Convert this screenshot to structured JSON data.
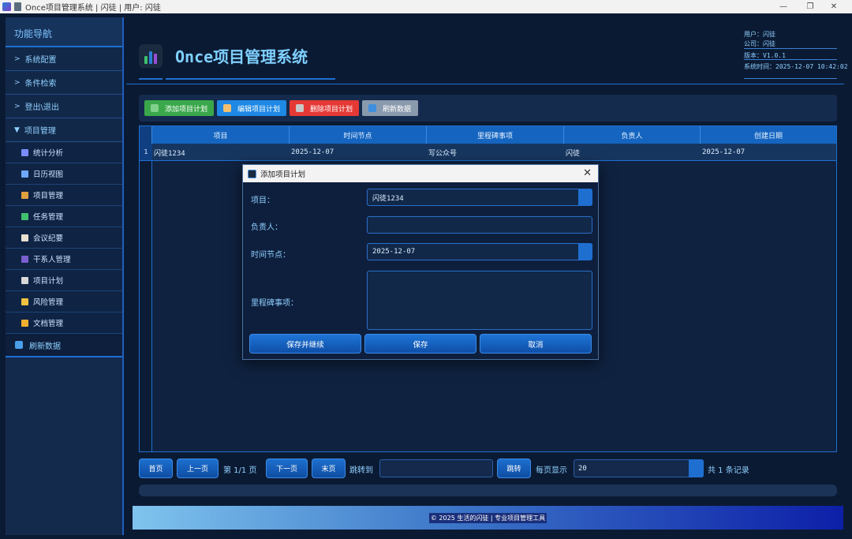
{
  "window": {
    "title": "Once项目管理系统 | 闪徒 | 用户: 闪徒"
  },
  "sidebar": {
    "header": "功能导航",
    "groups": [
      {
        "label": "系统配置",
        "chevron": ">"
      },
      {
        "label": "条件检索",
        "chevron": ">"
      },
      {
        "label": "登出\\退出",
        "chevron": ">"
      },
      {
        "label": "项目管理",
        "chevron": "▼"
      }
    ],
    "subitems": [
      {
        "label": "统计分析",
        "icon": "chart-icon",
        "color": "#7a8cff"
      },
      {
        "label": "日历视图",
        "icon": "calendar-icon",
        "color": "#6fa8ff"
      },
      {
        "label": "项目管理",
        "icon": "project-icon",
        "color": "#e0a040"
      },
      {
        "label": "任务管理",
        "icon": "check-icon",
        "color": "#3fbf6f"
      },
      {
        "label": "会议纪要",
        "icon": "memo-icon",
        "color": "#e8e0d0"
      },
      {
        "label": "干系人管理",
        "icon": "people-icon",
        "color": "#7a5fd0"
      },
      {
        "label": "项目计划",
        "icon": "clipboard-icon",
        "color": "#d8d8d8"
      },
      {
        "label": "风险管理",
        "icon": "warning-icon",
        "color": "#f0c040"
      },
      {
        "label": "文档管理",
        "icon": "folder-icon",
        "color": "#f0b030"
      }
    ],
    "refresh": "刷新数据"
  },
  "header": {
    "title": "Once项目管理系统",
    "user": "用户：闪徒",
    "company": "公司：闪徒",
    "version": "版本：V1.0.1",
    "time": "系统时间：2025-12-07 10:42:02"
  },
  "toolbar": {
    "add": "添加项目计划",
    "edit": "编辑项目计划",
    "delete": "删除项目计划",
    "refresh": "刷新数据"
  },
  "table": {
    "columns": [
      "项目",
      "时间节点",
      "里程碑事项",
      "负责人",
      "创建日期"
    ],
    "rows": [
      {
        "index": "1",
        "cells": [
          "闪徒1234",
          "2025-12-07",
          "写公众号",
          "闪徒",
          "2025-12-07"
        ]
      }
    ]
  },
  "dialog": {
    "title": "添加项目计划",
    "fields": {
      "project_label": "项目：",
      "project_value": "闪徒1234",
      "owner_label": "负责人：",
      "owner_value": "",
      "date_label": "时间节点：",
      "date_value": "2025-12-07",
      "milestone_label": "里程碑事项：",
      "milestone_value": ""
    },
    "buttons": {
      "save_continue": "保存并继续",
      "save": "保存",
      "cancel": "取消"
    }
  },
  "pagination": {
    "first": "首页",
    "prev": "上一页",
    "page_info": "第 1/1 页",
    "next": "下一页",
    "last": "末页",
    "jump_label": "跳转到",
    "jump_value": "",
    "jump_button": "跳转",
    "per_page_label": "每页显示",
    "per_page_value": "20",
    "total": "共 1 条记录"
  },
  "footer": {
    "text": "© 2025 生活的闪徒 | 专业项目管理工具"
  }
}
